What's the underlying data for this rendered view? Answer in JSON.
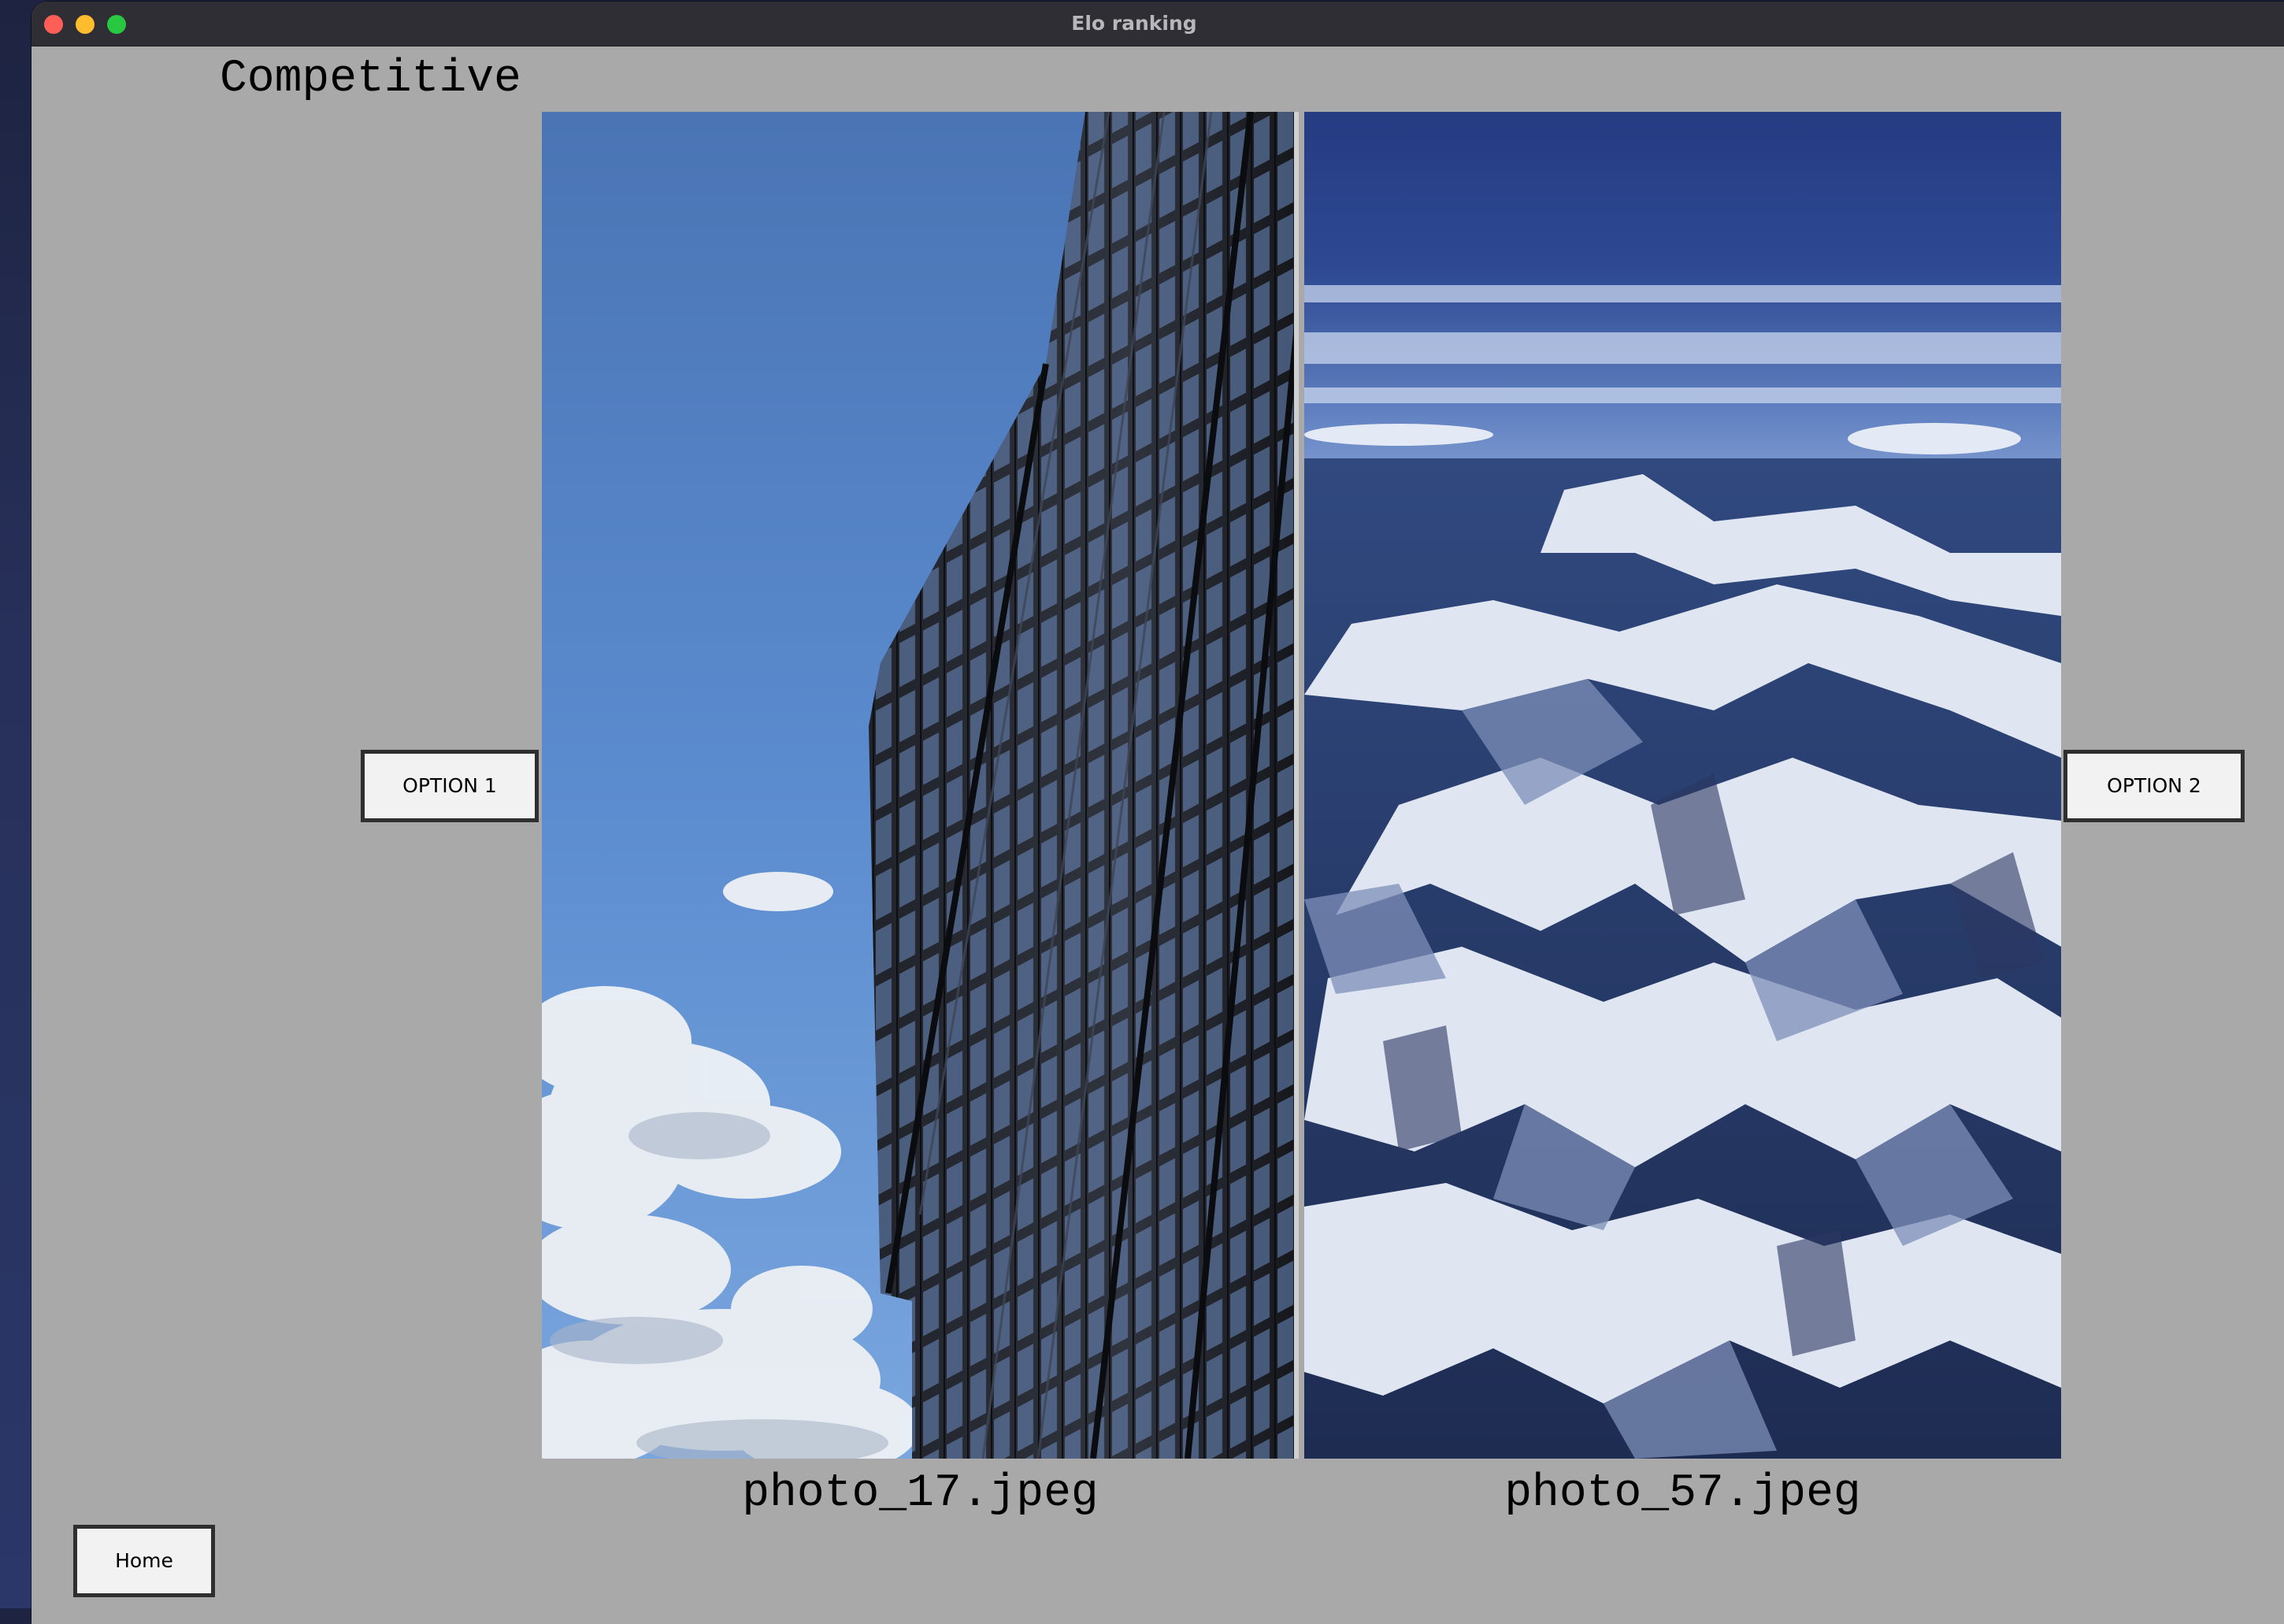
{
  "window": {
    "title": "Elo ranking"
  },
  "screen": {
    "mode_title": "Competitive"
  },
  "options": [
    {
      "button_label": "OPTION 1",
      "filename": "photo_17.jpeg",
      "image_subject": "glass skyscraper against blue sky with clouds"
    },
    {
      "button_label": "OPTION 2",
      "filename": "photo_57.jpeg",
      "image_subject": "aerial view of snow-covered mountains"
    }
  ],
  "nav": {
    "home_label": "Home"
  }
}
